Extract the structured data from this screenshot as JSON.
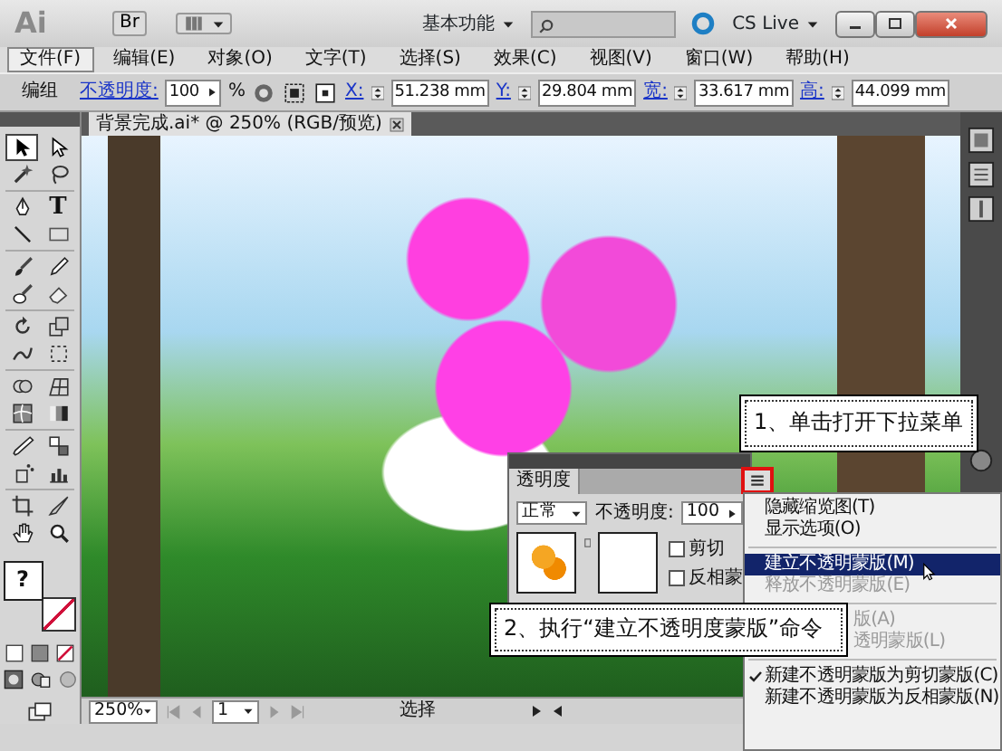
{
  "title_bar": {
    "app_logo": "Ai",
    "bridge_button": "Br",
    "workspace": "基本功能",
    "cs_live": "CS Live"
  },
  "menu": [
    {
      "label": "文件(F)",
      "selected": true
    },
    {
      "label": "编辑(E)",
      "selected": false
    },
    {
      "label": "对象(O)",
      "selected": false
    },
    {
      "label": "文字(T)",
      "selected": false
    },
    {
      "label": "选择(S)",
      "selected": false
    },
    {
      "label": "效果(C)",
      "selected": false
    },
    {
      "label": "视图(V)",
      "selected": false
    },
    {
      "label": "窗口(W)",
      "selected": false
    },
    {
      "label": "帮助(H)",
      "selected": false
    }
  ],
  "control_bar": {
    "selection_label": "编组",
    "opacity_label": "不透明度:",
    "opacity_value": "100",
    "opacity_unit": "%",
    "fields": [
      {
        "label": "X:",
        "value": "51.238 mm"
      },
      {
        "label": "Y:",
        "value": "29.804 mm"
      },
      {
        "label": "宽:",
        "value": "33.617 mm"
      },
      {
        "label": "高:",
        "value": "44.099 mm"
      }
    ]
  },
  "document_tab": {
    "title": "背景完成.ai* @ 250% (RGB/预览)"
  },
  "tools": [
    {
      "kind": "selection",
      "selected": true
    },
    {
      "kind": "direct",
      "selected": false
    },
    {
      "kind": "wand",
      "selected": false
    },
    {
      "kind": "lasso",
      "selected": false
    },
    {
      "kind": "pen",
      "selected": false
    },
    {
      "kind": "type",
      "glyph": "T",
      "selected": false
    },
    {
      "kind": "line",
      "selected": false
    },
    {
      "kind": "rectangle",
      "selected": false
    },
    {
      "kind": "brush",
      "selected": false
    },
    {
      "kind": "pencil",
      "selected": false
    },
    {
      "kind": "blob",
      "selected": false
    },
    {
      "kind": "eraser",
      "selected": false
    },
    {
      "kind": "rotate",
      "selected": false
    },
    {
      "kind": "scale",
      "selected": false
    },
    {
      "kind": "warp",
      "selected": false
    },
    {
      "kind": "transform",
      "selected": false
    },
    {
      "kind": "shapebuilder",
      "selected": false
    },
    {
      "kind": "perspective",
      "selected": false
    },
    {
      "kind": "mesh",
      "selected": false
    },
    {
      "kind": "gradient",
      "selected": false
    },
    {
      "kind": "eyedropper",
      "selected": false
    },
    {
      "kind": "blend",
      "selected": false
    },
    {
      "kind": "sprayer",
      "selected": false
    },
    {
      "kind": "graph",
      "selected": false
    },
    {
      "kind": "artboard",
      "selected": false
    },
    {
      "kind": "slice",
      "selected": false
    },
    {
      "kind": "hand",
      "selected": false
    },
    {
      "kind": "zoom",
      "selected": false
    }
  ],
  "fill_stroke": {
    "label": "?"
  },
  "transparency_panel": {
    "tab": "透明度",
    "blend_mode": "正常",
    "opacity_label": "不透明度:",
    "opacity_value": "100",
    "options": [
      {
        "label": "剪切",
        "checked": false
      },
      {
        "label": "反相蒙",
        "checked": false
      }
    ]
  },
  "panel_menu": {
    "items": [
      {
        "kind": "item",
        "label": "隐藏缩览图(T)",
        "disabled": false,
        "checked": false,
        "selected": false
      },
      {
        "kind": "item",
        "label": "显示选项(O)",
        "disabled": false,
        "checked": false,
        "selected": false
      },
      {
        "kind": "separator"
      },
      {
        "kind": "item",
        "label": "建立不透明蒙版(M)",
        "disabled": false,
        "checked": false,
        "selected": true
      },
      {
        "kind": "item",
        "label": "释放不透明蒙版(E)",
        "disabled": true,
        "checked": false,
        "selected": false
      },
      {
        "kind": "separator"
      },
      {
        "kind": "item",
        "label": "版(A)",
        "disabled": true,
        "selected": false,
        "obscured": true
      },
      {
        "kind": "item",
        "label": "透明蒙版(L)",
        "disabled": true,
        "selected": false,
        "obscured": true
      },
      {
        "kind": "separator"
      },
      {
        "kind": "item",
        "label": "新建不透明蒙版为剪切蒙版(C)",
        "disabled": false,
        "checked": true,
        "selected": false
      },
      {
        "kind": "item",
        "label": "新建不透明蒙版为反相蒙版(N)",
        "disabled": false,
        "checked": false,
        "selected": false
      }
    ]
  },
  "callouts": [
    "1、单击打开下拉菜单",
    "2、执行“建立不透明度蒙版”命令"
  ],
  "status_bar": {
    "zoom": "250%",
    "page": "1",
    "tool_label": "选择"
  }
}
